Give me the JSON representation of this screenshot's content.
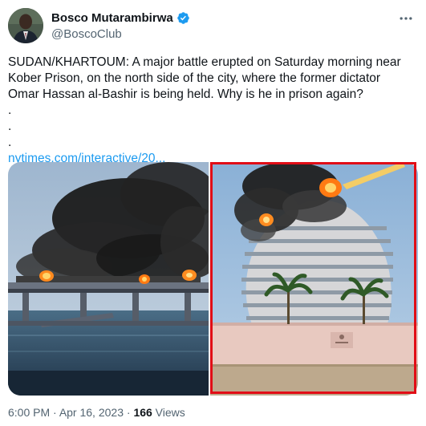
{
  "author": {
    "display_name": "Bosco Mutarambirwa",
    "handle": "@BoscoClub",
    "verified": true
  },
  "tweet": {
    "text": "SUDAN/KHARTOUM: A major battle erupted on Saturday morning near Kober Prison, on the north side of the city, where the former dictator Omar Hassan al-Bashir is being held. Why is he in prison again?",
    "dot_lines": [
      ".",
      ".",
      "."
    ],
    "link_text": "nytimes.com/interactive/20..."
  },
  "media": {
    "left_image": "burning bridge over water with black smoke",
    "right_image": "curved hotel tower on fire with black smoke, highlighted with red frame"
  },
  "meta": {
    "time": "6:00 PM",
    "separator1": " · ",
    "date": "Apr 16, 2023",
    "separator2": " · ",
    "views_count": "166",
    "views_label": " Views"
  },
  "colors": {
    "link": "#1d9bf0",
    "verified": "#1d9bf0",
    "highlight_frame": "#e10d16",
    "secondary_text": "#536471"
  }
}
